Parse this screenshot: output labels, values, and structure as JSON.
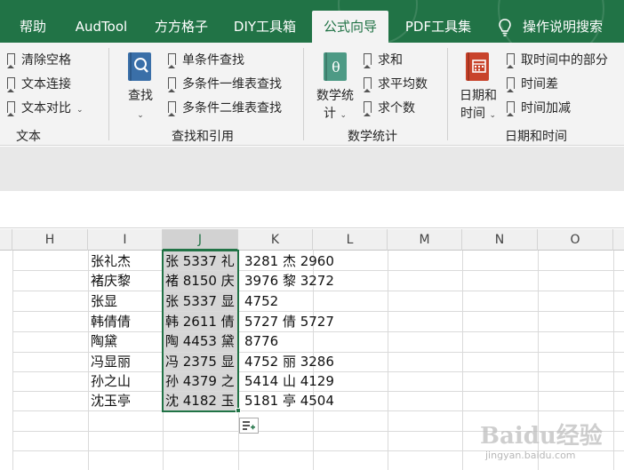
{
  "ribbon": {
    "tabs": [
      {
        "label": "帮助",
        "active": false
      },
      {
        "label": "AudTool",
        "active": false
      },
      {
        "label": "方方格子",
        "active": false
      },
      {
        "label": "DIY工具箱",
        "active": false
      },
      {
        "label": "公式向导",
        "active": true
      },
      {
        "label": "PDF工具集",
        "active": false
      }
    ],
    "tell_me": "操作说明搜索",
    "groups": {
      "text": {
        "label": "文本",
        "items": [
          "清除空格",
          "文本连接",
          "文本对比"
        ]
      },
      "lookup": {
        "label": "查找和引用",
        "button": "查找",
        "items": [
          "单条件查找",
          "多条件一维表查找",
          "多条件二维表查找"
        ]
      },
      "stats": {
        "label": "数学统计",
        "button_line1": "数学统",
        "button_line2": "计",
        "items": [
          "求和",
          "求平均数",
          "求个数"
        ]
      },
      "datetime": {
        "label": "日期和时间",
        "button_line1": "日期和",
        "button_line2": "时间",
        "items": [
          "取时间中的部分",
          "时间差",
          "时间加减"
        ]
      }
    }
  },
  "sheet": {
    "columns": [
      "H",
      "I",
      "J",
      "K",
      "L",
      "M",
      "N",
      "O"
    ],
    "selected_column": "J",
    "rows": [
      {
        "I": "张礼杰",
        "J": "张 5337 礼",
        "K": "3281 杰 2960"
      },
      {
        "I": "褚庆黎",
        "J": "褚 8150 庆",
        "K": "3976 黎 3272"
      },
      {
        "I": "张显",
        "J": "张 5337 显",
        "K": "4752"
      },
      {
        "I": "韩倩倩",
        "J": "韩 2611 倩",
        "K": "5727 倩 5727"
      },
      {
        "I": "陶黛",
        "J": "陶 4453 黛",
        "K": "8776"
      },
      {
        "I": "冯显丽",
        "J": "冯 2375 显",
        "K": "4752 丽 3286"
      },
      {
        "I": "孙之山",
        "J": "孙 4379 之",
        "K": "5414 山 4129"
      },
      {
        "I": "沈玉亭",
        "J": "沈 4182 玉",
        "K": "5181 亭 4504"
      }
    ]
  },
  "watermark": {
    "text": "Baidu经验",
    "url": "jingyan.baidu.com"
  },
  "colors": {
    "accent": "#217346",
    "ribbon_bg": "#f3f3f3",
    "book_teal": "#4d9a85",
    "book_blue": "#3a6fa8",
    "book_red": "#c8432b"
  }
}
